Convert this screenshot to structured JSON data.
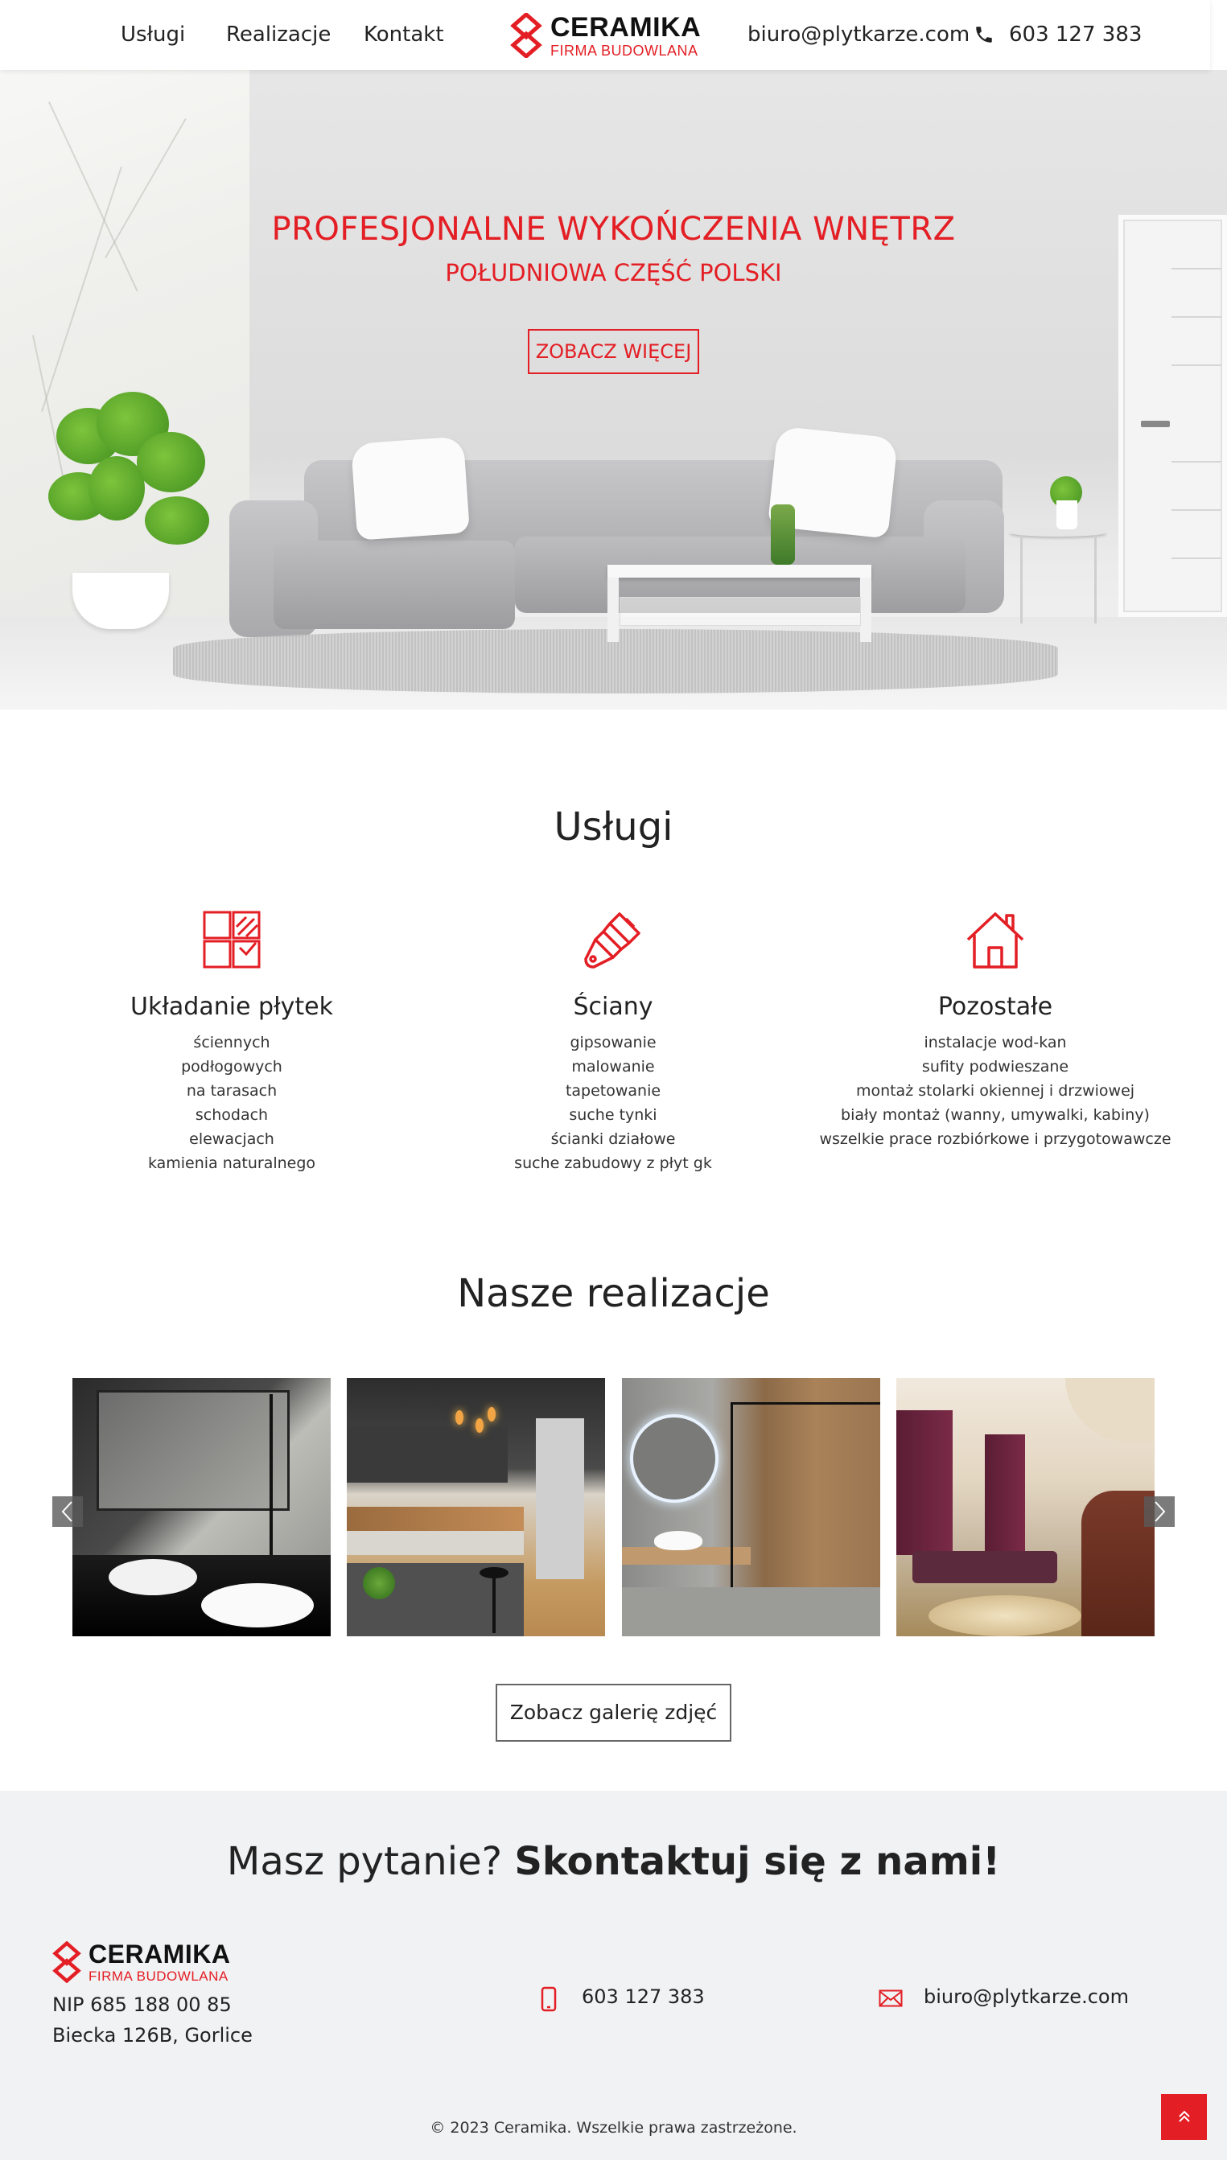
{
  "header": {
    "nav": [
      {
        "label": "Usługi"
      },
      {
        "label": "Realizacje"
      },
      {
        "label": "Kontakt"
      }
    ],
    "logo": {
      "name": "CERAMIKA",
      "tagline": "FIRMA BUDOWLANA"
    },
    "email": "biuro@plytkarze.com",
    "phone": "603 127 383"
  },
  "hero": {
    "title": "PROFESJONALNE WYKOŃCZENIA WNĘTRZ",
    "subtitle": "POŁUDNIOWA CZĘŚĆ POLSKI",
    "button": "ZOBACZ WIĘCEJ"
  },
  "services": {
    "title": "Usługi",
    "items": [
      {
        "icon": "tiles-icon",
        "title": "Układanie płytek",
        "list": [
          "ściennych",
          "podłogowych",
          "na tarasach",
          "schodach",
          "elewacjach",
          "kamienia naturalnego"
        ]
      },
      {
        "icon": "paint-brush-icon",
        "title": "Ściany",
        "list": [
          "gipsowanie",
          "malowanie",
          "tapetowanie",
          "suche tynki",
          "ścianki działowe",
          "suche zabudowy z płyt gk"
        ]
      },
      {
        "icon": "house-icon",
        "title": "Pozostałe",
        "list": [
          "instalacje wod-kan",
          "sufity podwieszane",
          "montaż stolarki okiennej i drzwiowej",
          "biały montaż (wanny, umywalki, kabiny)",
          "wszelkie prace rozbiórkowe i przygotowawcze"
        ]
      }
    ]
  },
  "gallery": {
    "title": "Nasze realizacje",
    "button": "Zobacz galerię zdjęć",
    "prev_icon": "chevron-left-icon",
    "next_icon": "chevron-right-icon"
  },
  "footer": {
    "heading_normal": "Masz pytanie?",
    "heading_bold": "Skontaktuj się z nami!",
    "nip": "NIP 685 188 00 85",
    "address": "Biecka 126B, Gorlice",
    "phone": "603 127 383",
    "email": "biuro@plytkarze.com",
    "copyright": "© 2023 Ceramika. Wszelkie prawa zastrzeżone."
  },
  "colors": {
    "accent": "#e31e24",
    "text": "#222222",
    "footer_bg": "#f1f2f4"
  }
}
